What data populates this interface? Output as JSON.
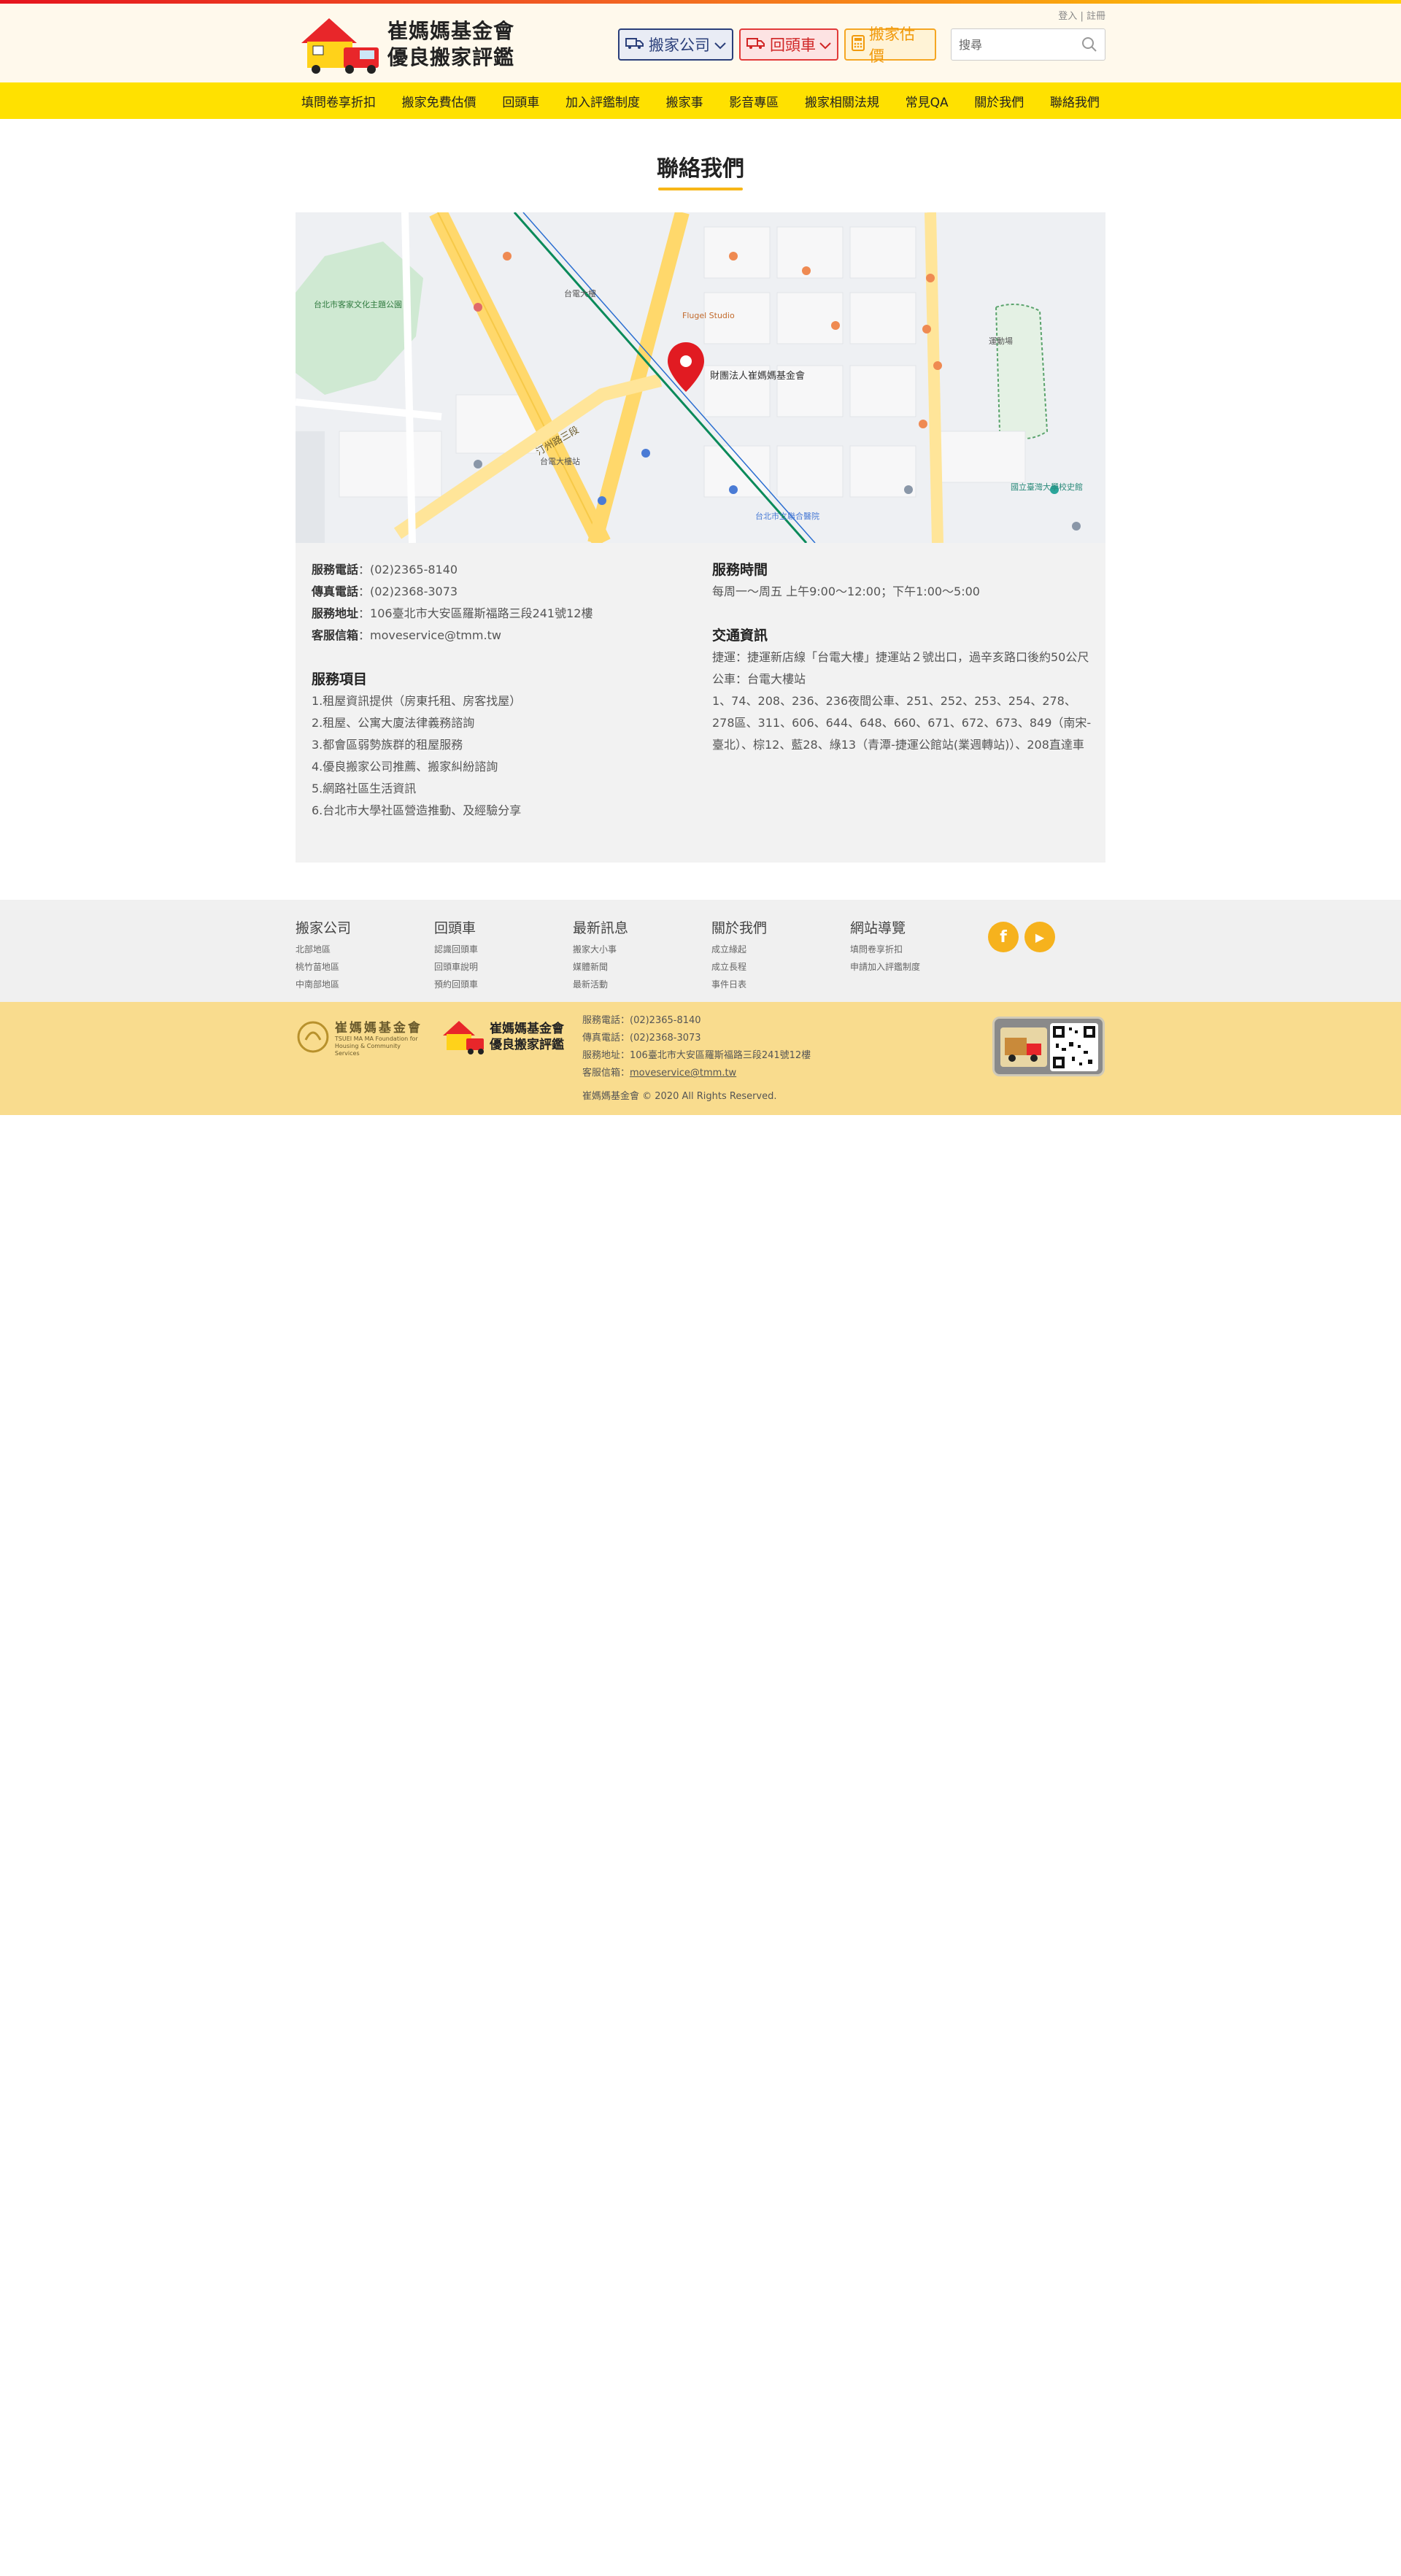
{
  "header": {
    "logo_line1": "崔媽媽基金會",
    "logo_line2": "優良搬家評鑑",
    "login_link": "登入",
    "separator": "|",
    "register_link": "註冊",
    "btn_move": "搬家公司",
    "btn_return": "回頭車",
    "btn_estimate": "搬家估價",
    "search_placeholder": "搜尋"
  },
  "nav": {
    "items": [
      "填問卷享折扣",
      "搬家免費估價",
      "回頭車",
      "加入評鑑制度",
      "搬家事",
      "影音專區",
      "搬家相關法規",
      "常見QA",
      "關於我們",
      "聯絡我們"
    ]
  },
  "page_title": "聯絡我們",
  "map": {
    "marker_label": "財團法人崔媽媽基金會",
    "labels": {
      "taipower": "台電大樓",
      "tingzhou": "汀州路三段",
      "station": "台電大樓站",
      "flugel": "Flugel Studio",
      "hospital": "台北市立聯合醫院",
      "sports": "運動場",
      "ntu": "國立臺灣大學校史館",
      "zhongzheng": "台北市客家文化主題公園"
    }
  },
  "contact": {
    "phone_label": "服務電話",
    "phone": "(02)2365-8140",
    "fax_label": "傳真電話",
    "fax": "(02)2368-3073",
    "address_label": "服務地址",
    "address": "106臺北市大安區羅斯福路三段241號12樓",
    "email_label": "客服信箱",
    "email": "moveservice@tmm.tw",
    "colon": "："
  },
  "services": {
    "heading": "服務項目",
    "items": [
      "1.租屋資訊提供（房東托租、房客找屋）",
      "2.租屋、公寓大廈法律義務諮詢",
      "3.都會區弱勢族群的租屋服務",
      "4.優良搬家公司推薦、搬家糾紛諮詢",
      "5.網路社區生活資訊",
      "6.台北市大學社區營造推動、及經驗分享"
    ]
  },
  "hours": {
    "heading": "服務時間",
    "text": "每周一～周五 上午9:00～12:00；下午1:00～5:00"
  },
  "transport": {
    "heading": "交通資訊",
    "mrt": "捷運：捷運新店線「台電大樓」捷運站２號出口，過辛亥路口後約50公尺",
    "bus_label": "公車：台電大樓站",
    "bus_routes": "1、74、208、236、236夜間公車、251、252、253、254、278、278區、311、606、644、648、660、671、672、673、849（南宋-臺北）、棕12、藍28、綠13（青潭-捷運公館站(業週轉站)）、208直達車"
  },
  "footer_nav": {
    "cols": [
      {
        "heading": "搬家公司",
        "links": [
          "北部地區",
          "桃竹苗地區",
          "中南部地區"
        ]
      },
      {
        "heading": "回頭車",
        "links": [
          "認識回頭車",
          "回頭車說明",
          "預約回頭車"
        ]
      },
      {
        "heading": "最新訊息",
        "links": [
          "搬家大小事",
          "媒體新聞",
          "最新活動"
        ]
      },
      {
        "heading": "關於我們",
        "links": [
          "成立緣起",
          "成立長程",
          "事件日表"
        ]
      },
      {
        "heading": "網站導覽",
        "links": [
          "填問卷享折扣",
          "申請加入評鑑制度"
        ]
      }
    ],
    "facebook_glyph": "f",
    "youtube_glyph": "▶"
  },
  "footer_bottom": {
    "tmm_name": "崔媽媽基金會",
    "tmm_en1": "TSUEI MA MA Foundation for",
    "tmm_en2": "Housing & Community Services",
    "eval_line1": "崔媽媽基金會",
    "eval_line2": "優良搬家評鑑",
    "phone": "服務電話：(02)2365-8140",
    "fax": "傳真電話：(02)2368-3073",
    "address": "服務地址：106臺北市大安區羅斯福路三段241號12樓",
    "email_label": "客服信箱：",
    "email": "moveservice@tmm.tw",
    "copyright": "崔媽媽基金會 © 2020 All Rights Reserved."
  },
  "colors": {
    "nav_bg": "#ffe100",
    "accent": "#f7b617",
    "move_btn": "#2b3f7a",
    "return_btn": "#e23a3a",
    "estimate_btn": "#f5a623",
    "footer_bottom_bg": "#f9dc8e"
  },
  "icons": [
    "truck-icon",
    "chevron-down-icon",
    "calculator-icon",
    "search-icon",
    "map-pin-icon",
    "facebook-icon",
    "youtube-icon",
    "qr-code-icon"
  ]
}
